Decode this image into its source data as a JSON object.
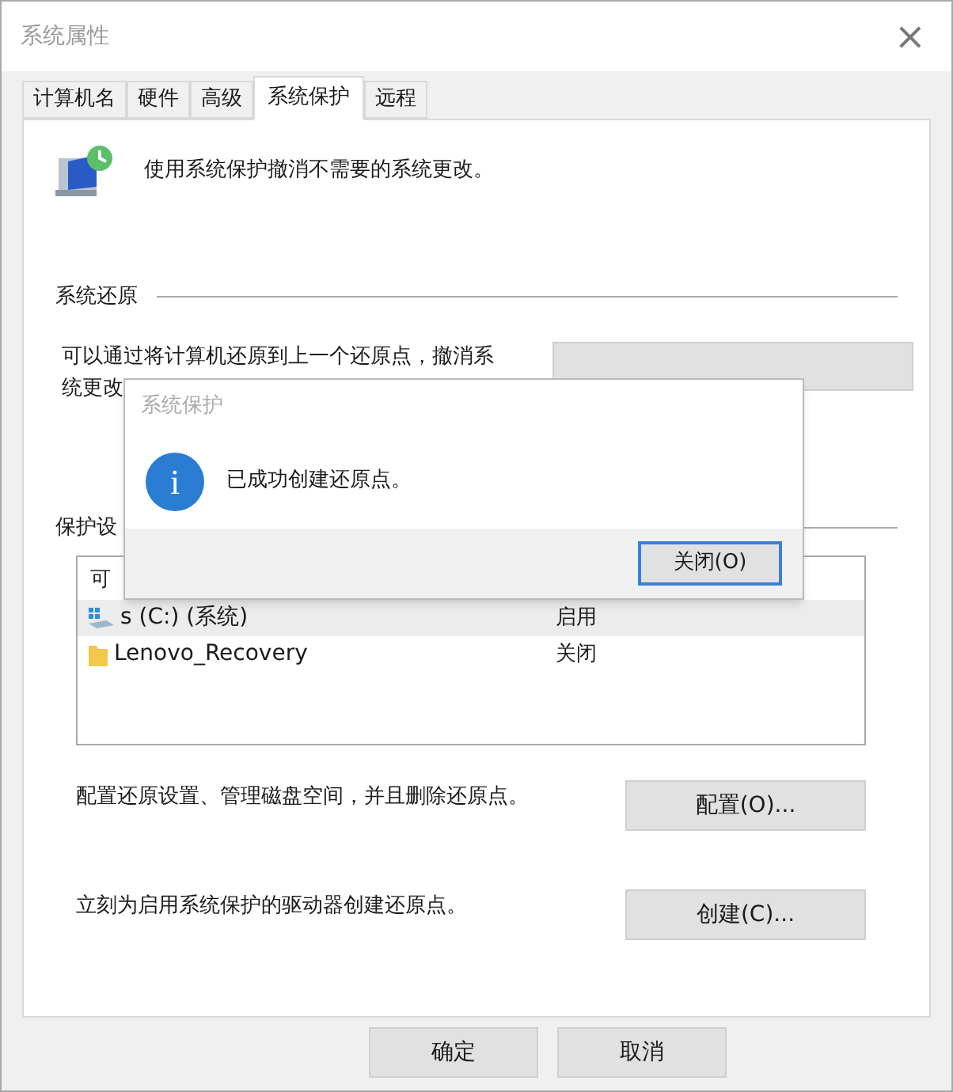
{
  "window": {
    "title": "系统属性",
    "close": "×"
  },
  "tabs": [
    {
      "label": "计算机名",
      "selected": false
    },
    {
      "label": "硬件",
      "selected": false
    },
    {
      "label": "高级",
      "selected": false
    },
    {
      "label": "系统保护",
      "selected": true
    },
    {
      "label": "远程",
      "selected": false
    }
  ],
  "intro": "使用系统保护撤消不需要的系统更改。",
  "restore": {
    "heading": "系统还原",
    "lines": [
      "可以通过将计算机还原到上一个还原点，撤消系",
      "统更改"
    ]
  },
  "protection": {
    "heading": "保护设",
    "column_1": "可",
    "drives": [
      {
        "name": "s (C:) (系统)",
        "status": "启用",
        "kind": "disk",
        "selected": true
      },
      {
        "name": "Lenovo_Recovery",
        "status": "关闭",
        "kind": "folder",
        "selected": false
      }
    ]
  },
  "configure": {
    "text": "配置还原设置、管理磁盘空间，并且删除还原点。",
    "button": "配置(O)..."
  },
  "create": {
    "text": "立刻为启用系统保护的驱动器创建还原点。",
    "button": "创建(C)..."
  },
  "buttons": [
    "确定",
    "取消"
  ],
  "dialog": {
    "title": "系统保护",
    "icon": "i",
    "message": "已成功创建还原点。",
    "button": "关闭(O)"
  }
}
